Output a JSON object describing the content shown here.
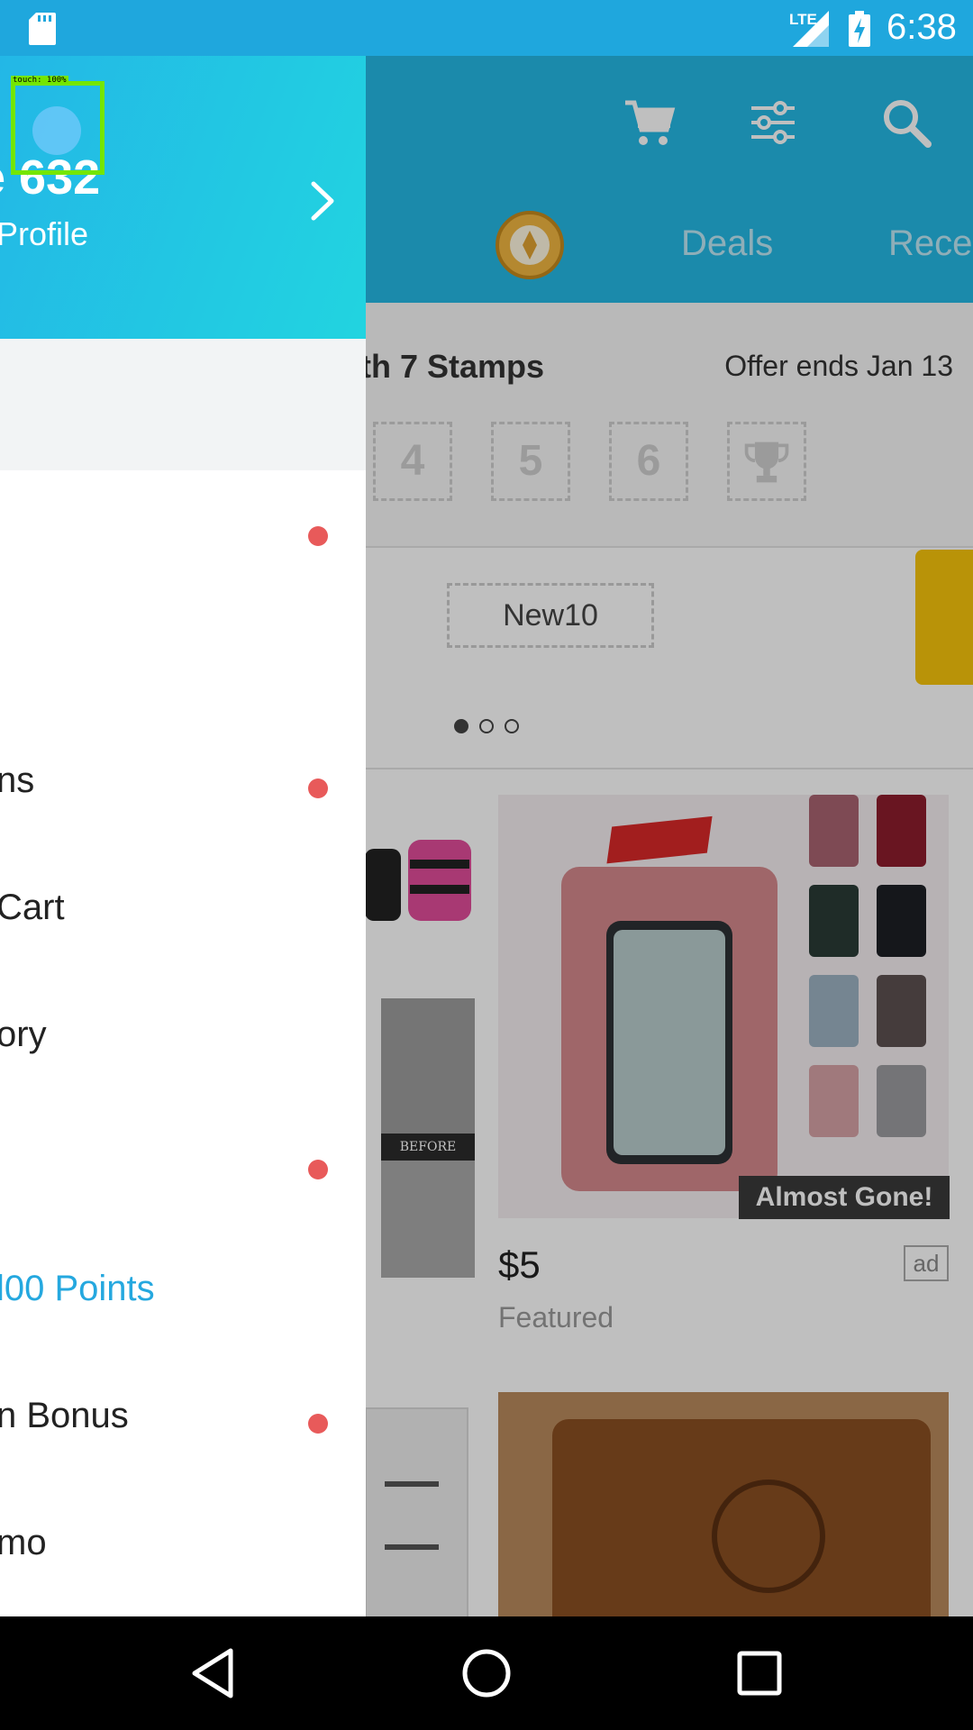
{
  "status_bar": {
    "network": "LTE",
    "time": "6:38",
    "icons": [
      "sd-card-icon",
      "signal-icon",
      "battery-charging-icon"
    ]
  },
  "app": {
    "header_icons": [
      "cart-icon",
      "filter-icon",
      "search-icon"
    ],
    "category_tabs": [
      "Deals",
      "Rece"
    ],
    "stamps_title": "th 7 Stamps",
    "offer_ends": "Offer ends Jan 13",
    "stamps": [
      "4",
      "5",
      "6"
    ],
    "coupon_code": "New10",
    "carousel_page": 1,
    "carousel_total": 3,
    "product": {
      "badge": "Almost Gone!",
      "price": "$5",
      "ad_label": "ad",
      "featured_label": "Featured"
    },
    "thumb_caption": "BEFORE"
  },
  "drawer": {
    "user_name": "e 632",
    "profile_link": "Profile",
    "items": [
      {
        "label": "",
        "dot": true
      },
      {
        "label": "ns",
        "dot": true
      },
      {
        "label": "Cart",
        "dot": false
      },
      {
        "label": "ory",
        "dot": false
      },
      {
        "label": "",
        "dot": true
      },
      {
        "label": "l00 Points",
        "dot": false
      },
      {
        "label": "n Bonus",
        "dot": true
      },
      {
        "label": "mo",
        "dot": false
      }
    ],
    "touch_indicator": "touch: 100%"
  },
  "colors": {
    "status_bar": "#1fa7dd",
    "header": "#25b8e4",
    "accent": "#25a8df",
    "notification_dot": "#e85a5a",
    "touch_box": "#74e600"
  },
  "nav_bar": {
    "buttons": [
      "back-icon",
      "home-icon",
      "recents-icon"
    ]
  }
}
